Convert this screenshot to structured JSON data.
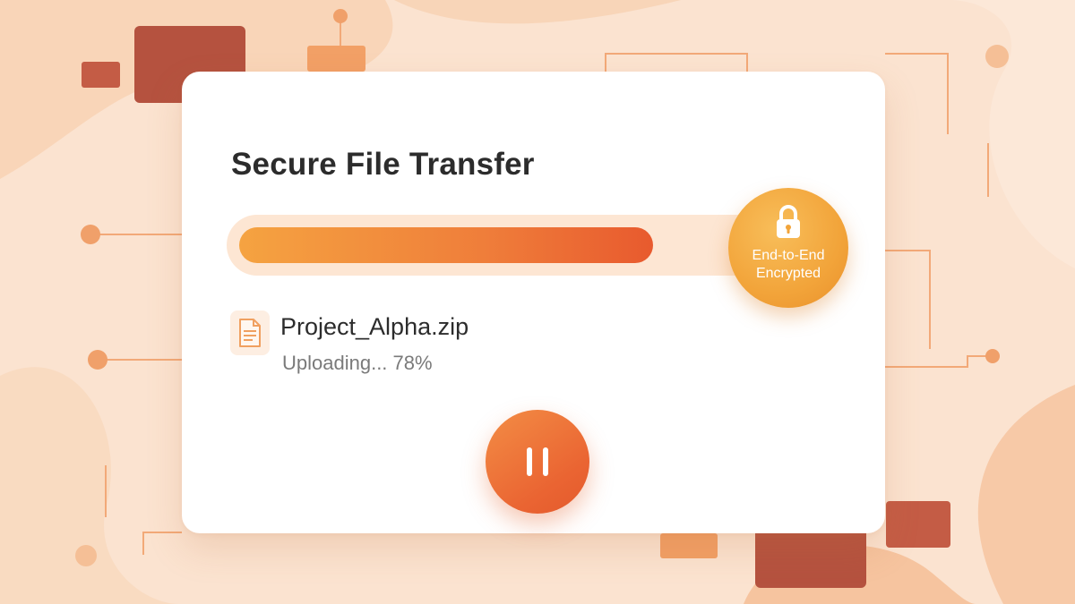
{
  "dialog": {
    "title": "Secure File Transfer",
    "progress_fraction": 0.78,
    "badge": {
      "line1": "End-to-End",
      "line2": "Encrypted",
      "icon": "lock-icon"
    },
    "file": {
      "icon": "document-icon",
      "name": "Project_Alpha.zip",
      "status": "Uploading... 78%"
    },
    "pause_button": {
      "icon": "pause-icon"
    }
  },
  "colors": {
    "accent": "#ef7d3a",
    "badge": "#f2a43a",
    "background": "#fbe3d0",
    "card": "#ffffff",
    "track": "#fde6d3"
  }
}
